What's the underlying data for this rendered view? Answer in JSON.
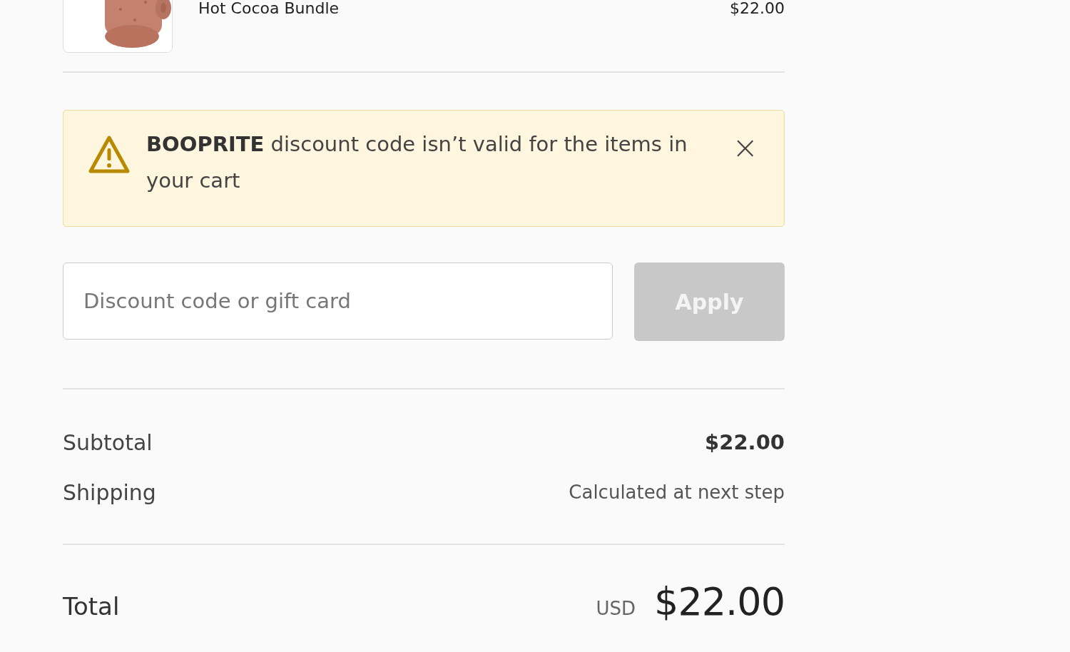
{
  "product": {
    "name": "Hot Cocoa Bundle",
    "price": "$22.00"
  },
  "alert": {
    "message": "**BOOPRITE** discount code isn’t valid for the items in your cart",
    "dismiss": "×"
  },
  "discount": {
    "placeholder": "Discount code or gift card",
    "button": "Apply",
    "disabled": true
  },
  "summary": [
    {
      "label": "Subtotal",
      "value": "$22.00",
      "kind": "amount"
    },
    {
      "label": "Shipping",
      "value": "Calculated at next step",
      "kind": "note"
    }
  ],
  "total": {
    "label": "Total",
    "currency": "USD",
    "value": "$22.00"
  }
}
